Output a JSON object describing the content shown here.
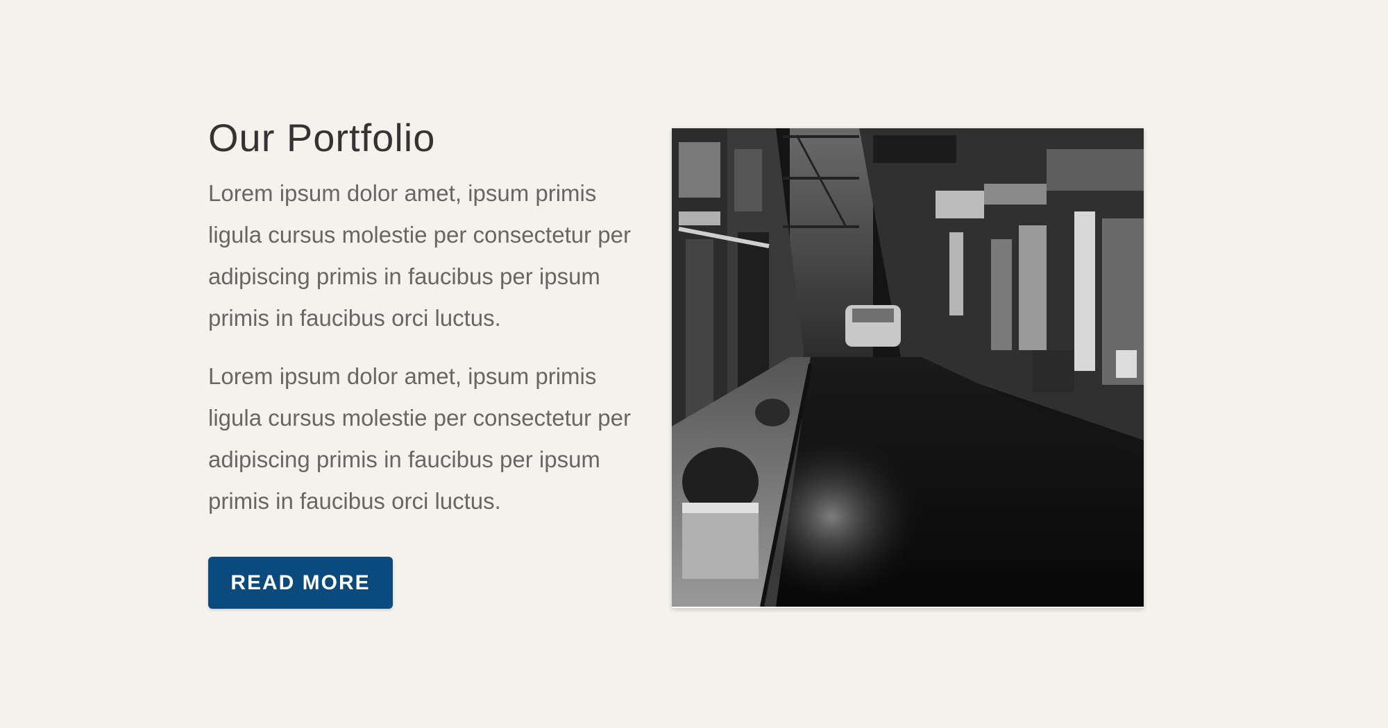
{
  "portfolio": {
    "title": "Our Portfolio",
    "paragraphs": [
      "Lorem ipsum dolor amet, ipsum primis ligula cursus molestie per consectetur per adipiscing primis in faucibus per ipsum primis in faucibus orci luctus.",
      "Lorem ipsum dolor amet, ipsum primis ligula cursus molestie per consectetur per adipiscing primis in faucibus per ipsum primis in faucibus orci luctus."
    ],
    "button_label": "READ MORE"
  },
  "image": {
    "subject": "black and white night street scene with shops and parked cars"
  },
  "colors": {
    "background": "#f5f2ed",
    "title": "#333333",
    "body_text": "#666666",
    "button": "#0a4a7c",
    "button_text": "#ffffff"
  }
}
